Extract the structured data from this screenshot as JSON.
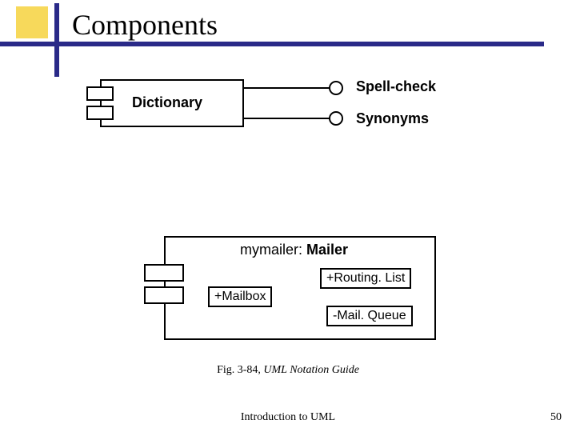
{
  "title": "Components",
  "components": {
    "dictionary": {
      "label": "Dictionary",
      "interfaces": [
        "Spell-check",
        "Synonyms"
      ]
    },
    "mailer": {
      "instance_prefix": "mymailer: ",
      "class": "Mailer",
      "parts": {
        "mailbox": "+Mailbox",
        "routing": "+Routing. List",
        "queue": "-Mail. Queue"
      }
    }
  },
  "caption": {
    "lead": "Fig. 3-84, ",
    "rest": "UML Notation Guide"
  },
  "footer": "Introduction to UML",
  "page_number": "50"
}
